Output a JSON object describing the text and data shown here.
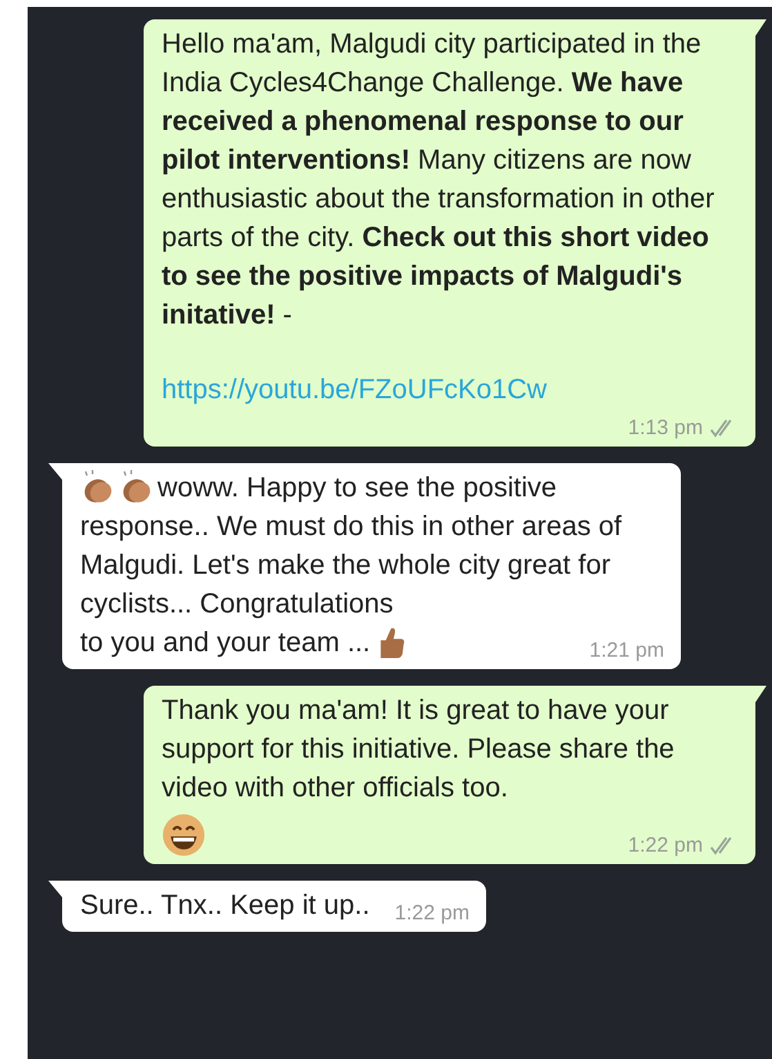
{
  "messages": [
    {
      "kind": "sent",
      "rows": [
        [
          {
            "kind": "text",
            "text": "Hello ma'am, Malgudi city participated in the India Cycles4Change Challenge. **We have received a phenomenal response to our pilot interventions!** Many citizens are now enthusiastic about the transformation in other parts of the city. **Check out this short video to see the positive impacts of Malgudi's initative!** -"
          }
        ],
        [
          {
            "kind": "link",
            "text": "https://youtu.be/FZoUFcKo1Cw"
          }
        ]
      ],
      "time": "1:13 pm",
      "delivered": true
    },
    {
      "kind": "received",
      "rows": [
        [
          {
            "kind": "clap"
          },
          {
            "kind": "clap"
          },
          {
            "kind": "text",
            "text": "woww. Happy to see the positive"
          }
        ],
        [
          {
            "kind": "text",
            "text": "response.. We must do this in other areas of Malgudi. Let's make the whole city great for cyclists... Congratulations"
          }
        ],
        [
          {
            "kind": "text",
            "text": "to you and your team ..."
          },
          {
            "kind": "thumbs"
          }
        ]
      ],
      "time": "1:21 pm"
    },
    {
      "kind": "sent",
      "rows": [
        [
          {
            "kind": "text",
            "text": "Thank you ma'am! It is great to have your support for this initiative. Please share the video with other officials too."
          }
        ],
        [
          {
            "kind": "grin"
          }
        ]
      ],
      "time": "1:22 pm",
      "delivered": true
    },
    {
      "kind": "received",
      "rows": [
        [
          {
            "kind": "text",
            "text": "Sure.. Tnx.. Keep it up.."
          }
        ]
      ],
      "time": "1:22 pm"
    }
  ]
}
